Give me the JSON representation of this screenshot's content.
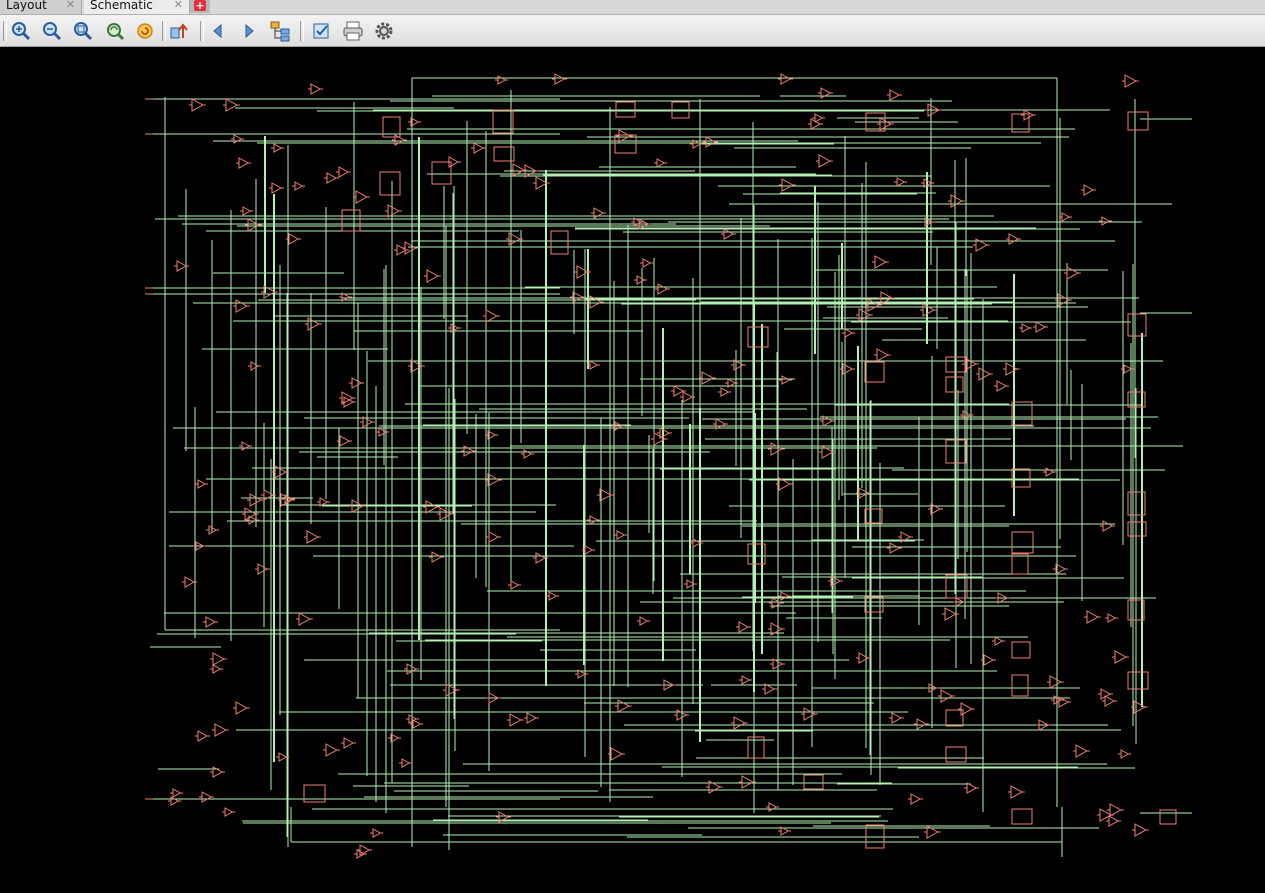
{
  "tabs": [
    {
      "label": "Layout",
      "active": false
    },
    {
      "label": "Schematic",
      "active": true
    }
  ],
  "new_tab_icon": "plus-icon",
  "toolbar": {
    "buttons": [
      {
        "name": "zoom-in-icon"
      },
      {
        "name": "zoom-out-icon"
      },
      {
        "name": "zoom-fit-icon"
      },
      {
        "name": "zoom-area-icon"
      },
      {
        "name": "refresh-icon"
      },
      {
        "name": "go-to-parent-icon"
      },
      {
        "name": "back-icon"
      },
      {
        "name": "forward-icon"
      },
      {
        "name": "hierarchy-icon"
      },
      {
        "name": "select-edit-icon"
      },
      {
        "name": "print-icon"
      },
      {
        "name": "settings-icon"
      }
    ]
  },
  "colors": {
    "background": "#000000",
    "wire": "#b4f0b4",
    "cell": "#f08070",
    "toolbar": "#e6e6e6"
  }
}
